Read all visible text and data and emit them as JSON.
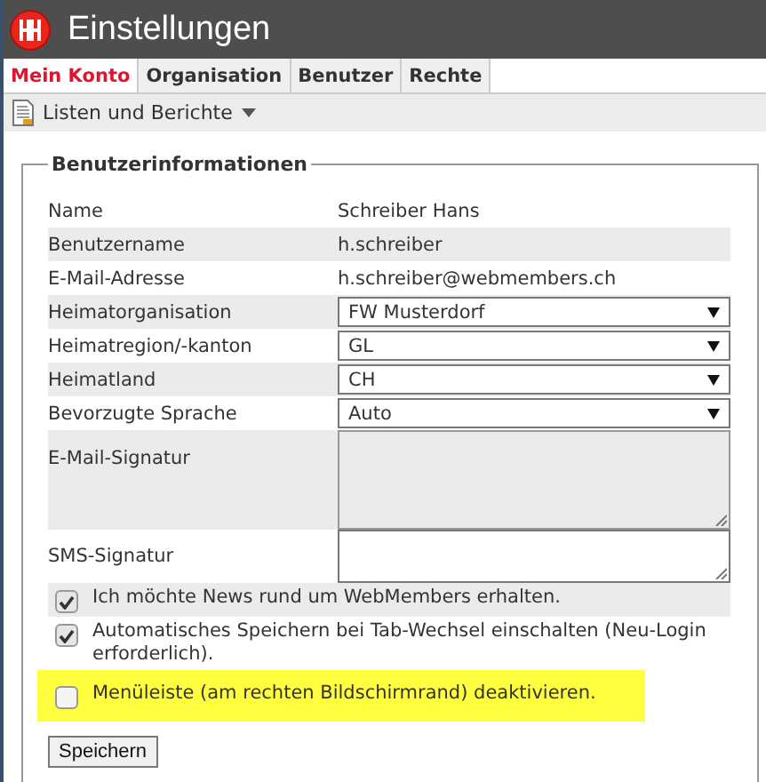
{
  "window": {
    "title": "Einstellungen"
  },
  "tabs": [
    {
      "label": "Mein Konto",
      "selected": true
    },
    {
      "label": "Organisation",
      "selected": false
    },
    {
      "label": "Benutzer",
      "selected": false
    },
    {
      "label": "Rechte",
      "selected": false
    }
  ],
  "toolbar": {
    "menu": "Listen und Berichte"
  },
  "fieldset": {
    "legend": "Benutzerinformationen",
    "fields": [
      {
        "kind": "text",
        "label": "Name",
        "value": "Schreiber Hans"
      },
      {
        "kind": "text",
        "label": "Benutzername",
        "value": "h.schreiber"
      },
      {
        "kind": "text",
        "label": "E-Mail-Adresse",
        "value": "h.schreiber@webmembers.ch"
      },
      {
        "kind": "select",
        "label": "Heimatorganisation",
        "value": "FW Musterdorf"
      },
      {
        "kind": "select",
        "label": "Heimatregion/-kanton",
        "value": "GL"
      },
      {
        "kind": "select",
        "label": "Heimatland",
        "value": "CH"
      },
      {
        "kind": "select",
        "label": "Bevorzugte Sprache",
        "value": "Auto"
      },
      {
        "kind": "textarea",
        "label": "E-Mail-Signatur",
        "disabled": true
      },
      {
        "kind": "textarea",
        "label": "SMS-Signatur",
        "disabled": false
      }
    ],
    "options": [
      {
        "label": "Ich möchte News rund um WebMembers erhalten.",
        "checked": true,
        "highlighted": false
      },
      {
        "label": "Automatisches Speichern bei Tab-Wechsel einschalten (Neu-Login erforderlich).",
        "checked": true,
        "highlighted": false
      },
      {
        "label": "Menüleiste (am rechten Bildschirmrand) deaktivieren.",
        "checked": false,
        "highlighted": true
      }
    ],
    "save_button": "Speichern"
  }
}
